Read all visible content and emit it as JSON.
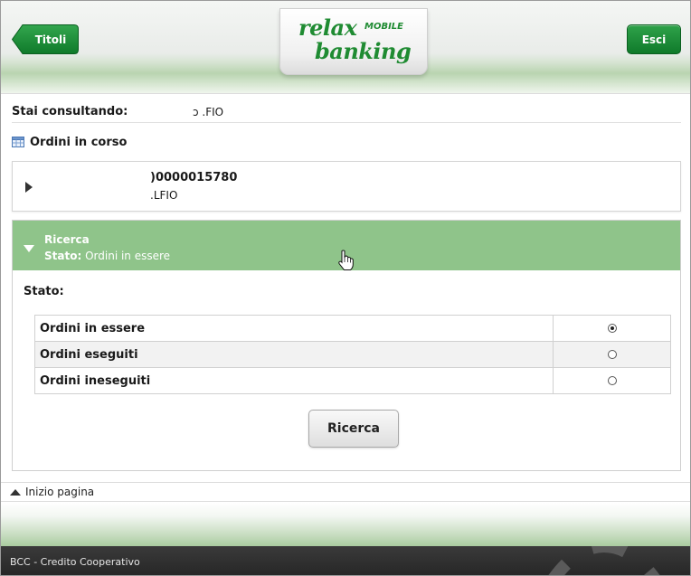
{
  "header": {
    "back_label": "Titoli",
    "exit_label": "Esci",
    "logo_relax": "relax",
    "logo_mobile": "MOBILE",
    "logo_banking": "banking",
    "accent_color": "#1f8b32"
  },
  "consult": {
    "label": "Stai consultando:",
    "value": "ↄ .FIO"
  },
  "section": {
    "title": "Ordini in corso",
    "icon": "table-icon"
  },
  "account": {
    "number": ")0000015780",
    "name": ".LFIO"
  },
  "search": {
    "title": "Ricerca",
    "status_prefix": "Stato:",
    "status_value": "Ordini in essere",
    "stato_label": "Stato:",
    "options": [
      {
        "label": "Ordini in essere",
        "checked": true
      },
      {
        "label": "Ordini eseguiti",
        "checked": false
      },
      {
        "label": "Ordini ineseguiti",
        "checked": false
      }
    ],
    "button_label": "Ricerca"
  },
  "top_link": {
    "label": "Inizio pagina"
  },
  "footer": {
    "text": "BCC - Credito Cooperativo"
  }
}
